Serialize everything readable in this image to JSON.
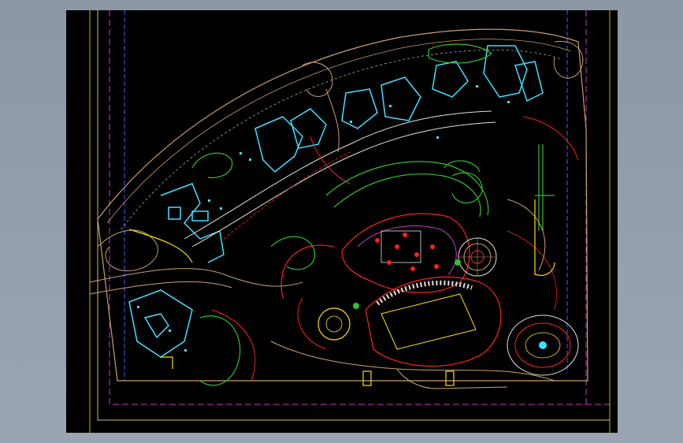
{
  "viewer": {
    "background_color": "#949fae"
  },
  "canvas": {
    "background_color": "#000000"
  },
  "colors": {
    "boundary_magenta": "#c040c0",
    "boundary_blue": "#4060ff",
    "path_tan": "#c8a070",
    "building_cyan": "#40e0ff",
    "hedge_green": "#30c030",
    "yellow": "#ffe000",
    "red": "#ff2020",
    "white": "#e0e0e0"
  },
  "icons": {
    "plaza_center": "circle-icon",
    "fountain": "radial-circle-icon"
  }
}
